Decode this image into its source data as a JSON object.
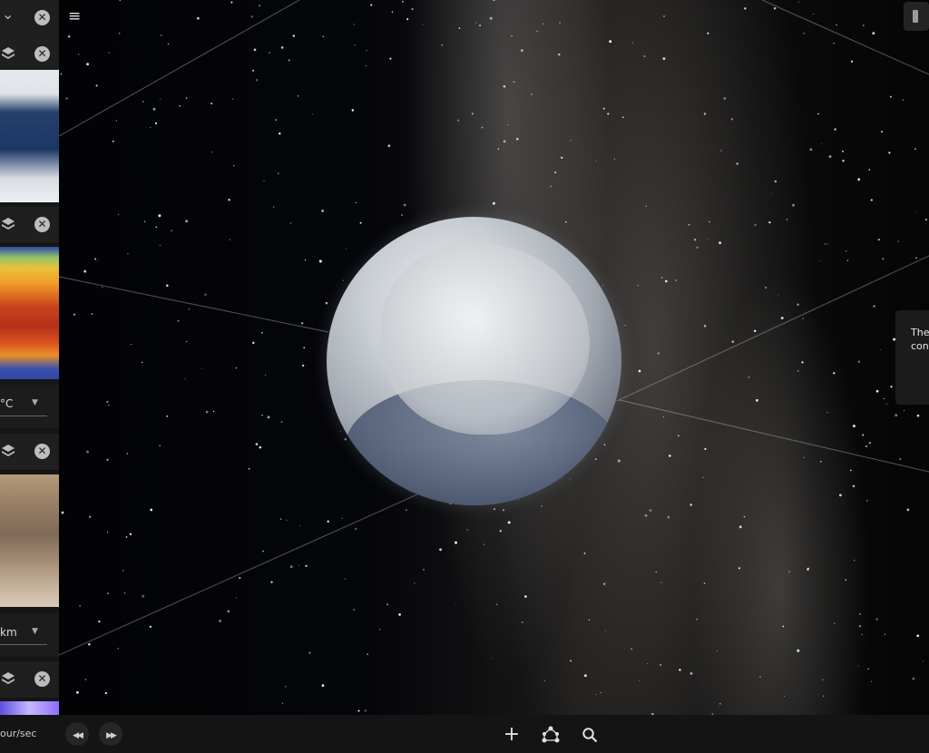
{
  "sidebar": {
    "rows": [
      {
        "id": "row0",
        "has_chevron": true
      },
      {
        "id": "row1"
      },
      {
        "id": "row2"
      },
      {
        "id": "row3"
      },
      {
        "id": "row4"
      }
    ],
    "close_glyph": "✕",
    "chevron_glyph": "⌄",
    "select1_value": "°C",
    "select2_value": "km",
    "select_arrow": "▼"
  },
  "header": {
    "menu_icon": "menu-icon",
    "menu_glyph": "≡",
    "top_right_icon": "light-icon"
  },
  "info_panel": {
    "line1": "The",
    "line2": "conc"
  },
  "bottombar": {
    "speed_label": "our/sec",
    "rewind_glyph": "◀◀",
    "forward_glyph": "▶▶",
    "add_glyph": "+",
    "share_glyph": "⟡",
    "search_glyph": "⚲"
  },
  "colors": {
    "sidebar_bg": "#161616",
    "panel_bg": "#1b1b1c",
    "bottombar_bg": "#141414"
  }
}
